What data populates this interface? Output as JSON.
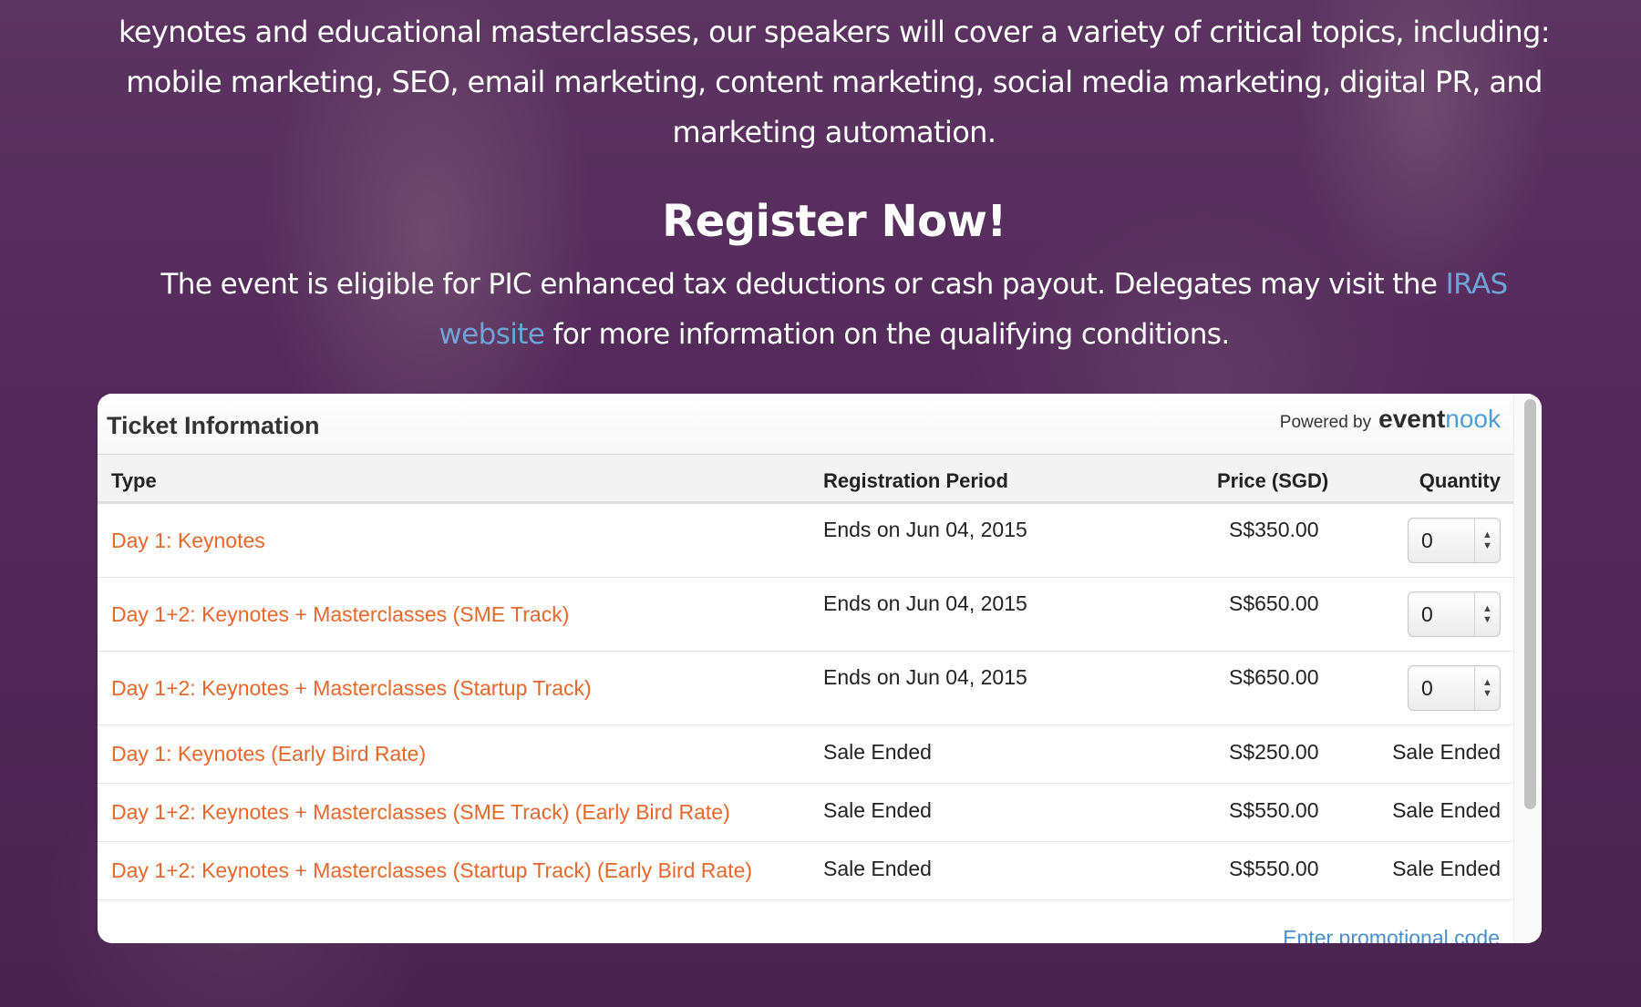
{
  "intro": {
    "text": "keynotes and educational masterclasses, our speakers will cover a variety of critical topics, including: mobile marketing, SEO, email marketing, content marketing, social media marketing, digital PR, and marketing automation."
  },
  "register": {
    "title": "Register Now!",
    "text_before": "The event is eligible for PIC enhanced tax deductions or cash payout. Delegates may visit the ",
    "link_text": "IRAS website",
    "text_after": " for more information on the qualifying conditions."
  },
  "widget": {
    "title": "Ticket Information",
    "powered_by": "Powered by",
    "brand_main": "event",
    "brand_accent": "nook",
    "columns": {
      "type": "Type",
      "period": "Registration Period",
      "price": "Price (SGD)",
      "quantity": "Quantity"
    },
    "tickets": [
      {
        "name": "Day 1: Keynotes",
        "period": "Ends on Jun 04, 2015",
        "price": "S$350.00",
        "quantity": "0"
      },
      {
        "name": "Day 1+2: Keynotes + Masterclasses (SME Track)",
        "period": "Ends on Jun 04, 2015",
        "price": "S$650.00",
        "quantity": "0"
      },
      {
        "name": "Day 1+2: Keynotes + Masterclasses (Startup Track)",
        "period": "Ends on Jun 04, 2015",
        "price": "S$650.00",
        "quantity": "0"
      },
      {
        "name": "Day 1: Keynotes (Early Bird Rate)",
        "period": "Sale Ended",
        "price": "S$250.00",
        "quantity": "Sale Ended"
      },
      {
        "name": "Day 1+2: Keynotes + Masterclasses (SME Track) (Early Bird Rate)",
        "period": "Sale Ended",
        "price": "S$550.00",
        "quantity": "Sale Ended"
      },
      {
        "name": "Day 1+2: Keynotes + Masterclasses (Startup Track) (Early Bird Rate)",
        "period": "Sale Ended",
        "price": "S$550.00",
        "quantity": "Sale Ended"
      }
    ],
    "promo_link": "Enter promotional code"
  },
  "colors": {
    "background": "#4d2752",
    "ticket_name": "#e8672a",
    "link": "#6fa3d6",
    "brand_accent": "#4d9fd3"
  },
  "icons": {
    "stepper": "up-down-arrows-icon"
  }
}
